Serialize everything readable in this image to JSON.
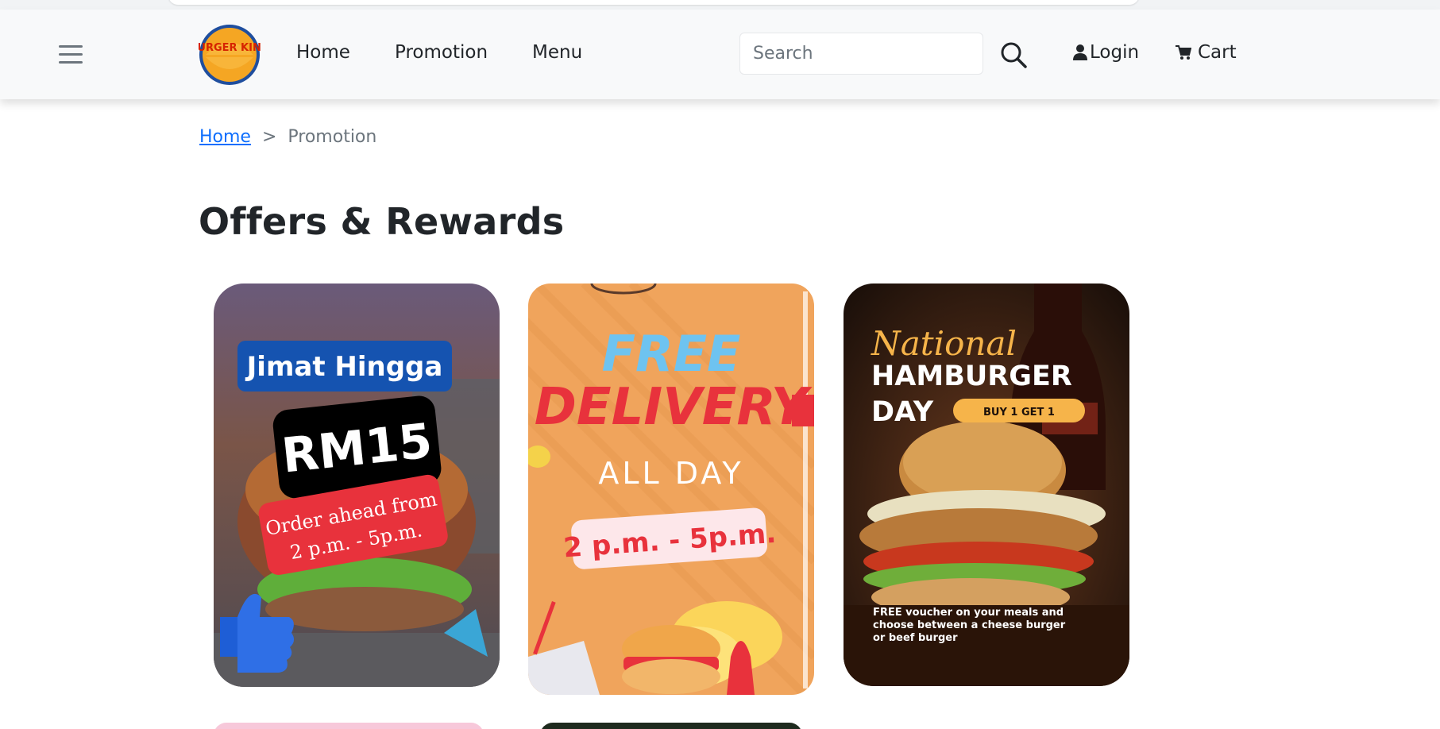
{
  "nav": {
    "logo_text": "BURGER KING",
    "links": [
      {
        "label": "Home"
      },
      {
        "label": "Promotion"
      },
      {
        "label": "Menu"
      }
    ],
    "search_placeholder": "Search",
    "login_label": "Login",
    "cart_label": "Cart"
  },
  "breadcrumb": {
    "home": "Home",
    "separator": ">",
    "current": "Promotion"
  },
  "page_title": "Offers & Rewards",
  "promotions": [
    {
      "badge": "Jimat Hingga",
      "amount": "RM15",
      "line1": "Order  ahead from",
      "line2": "2 p.m. - 5p.m."
    },
    {
      "headline1": "FREE",
      "headline2": "DELIVERY",
      "subhead": "ALL DAY",
      "time": "2 p.m. - 5p.m."
    },
    {
      "script": "National",
      "headline1": "HAMBURGER",
      "headline2": "DAY",
      "tag": "BUY 1 GET 1",
      "caption1": "FREE voucher on your meals and",
      "caption2": "choose between a cheese burger",
      "caption3": "or beef burger"
    }
  ],
  "colors": {
    "brand_red": "#d62300",
    "brand_orange": "#f5a623",
    "link_blue": "#0d6efd"
  }
}
